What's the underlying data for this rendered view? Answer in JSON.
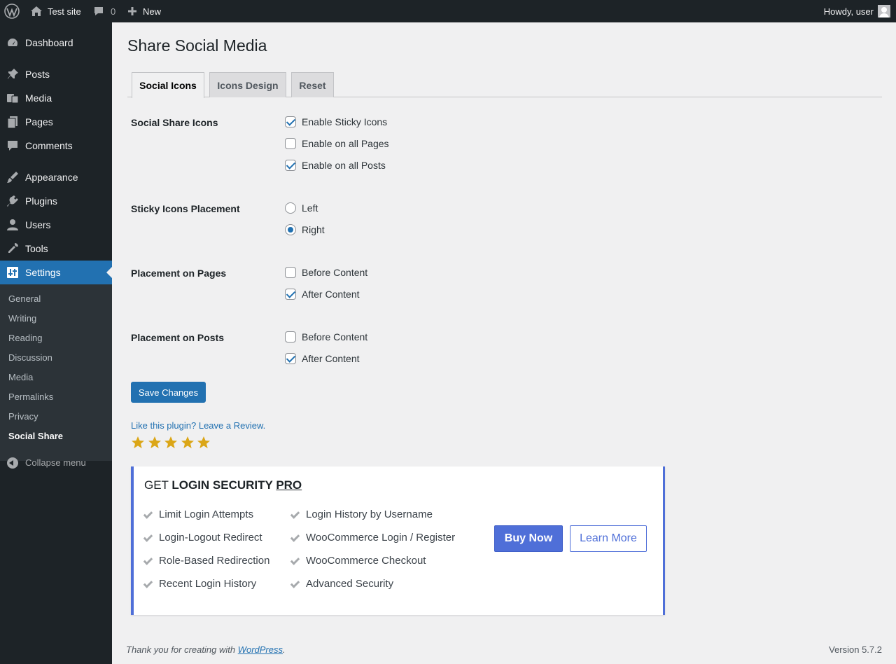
{
  "adminbar": {
    "site_name": "Test site",
    "comments_count": "0",
    "new_label": "New",
    "howdy": "Howdy, user"
  },
  "sidebar": {
    "items": [
      {
        "label": "Dashboard",
        "icon": "dashboard-icon"
      },
      {
        "label": "Posts",
        "icon": "pushpin-icon"
      },
      {
        "label": "Media",
        "icon": "media-icon"
      },
      {
        "label": "Pages",
        "icon": "pages-icon"
      },
      {
        "label": "Comments",
        "icon": "comment-icon"
      },
      {
        "label": "Appearance",
        "icon": "brush-icon"
      },
      {
        "label": "Plugins",
        "icon": "plugin-icon"
      },
      {
        "label": "Users",
        "icon": "user-icon"
      },
      {
        "label": "Tools",
        "icon": "wrench-icon"
      },
      {
        "label": "Settings",
        "icon": "settings-icon"
      }
    ],
    "submenu": [
      "General",
      "Writing",
      "Reading",
      "Discussion",
      "Media",
      "Permalinks",
      "Privacy",
      "Social Share"
    ],
    "collapse_label": "Collapse menu"
  },
  "page": {
    "title": "Share Social Media",
    "tabs": [
      "Social Icons",
      "Icons Design",
      "Reset"
    ]
  },
  "settings": {
    "social_share_icons": {
      "label": "Social Share Icons",
      "options": [
        {
          "label": "Enable Sticky Icons",
          "checked": true
        },
        {
          "label": "Enable on all Pages",
          "checked": false
        },
        {
          "label": "Enable on all Posts",
          "checked": true
        }
      ]
    },
    "sticky_placement": {
      "label": "Sticky Icons Placement",
      "options": [
        {
          "label": "Left",
          "checked": false
        },
        {
          "label": "Right",
          "checked": true
        }
      ]
    },
    "placement_pages": {
      "label": "Placement on Pages",
      "options": [
        {
          "label": "Before Content",
          "checked": false
        },
        {
          "label": "After Content",
          "checked": true
        }
      ]
    },
    "placement_posts": {
      "label": "Placement on Posts",
      "options": [
        {
          "label": "Before Content",
          "checked": false
        },
        {
          "label": "After Content",
          "checked": true
        }
      ]
    },
    "save_label": "Save Changes"
  },
  "review": {
    "link_text": "Like this plugin? Leave a Review.",
    "stars": 5
  },
  "promo": {
    "title_prefix": "GET ",
    "title_bold": "LOGIN SECURITY ",
    "title_pro": "PRO",
    "features_col1": [
      "Limit Login Attempts",
      "Login-Logout Redirect",
      "Role-Based Redirection",
      "Recent Login History"
    ],
    "features_col2": [
      "Login History by Username",
      "WooCommerce Login / Register",
      "WooCommerce Checkout",
      "Advanced Security"
    ],
    "buy_label": "Buy Now",
    "learn_label": "Learn More",
    "accent_color": "#4f6fd8"
  },
  "footer": {
    "thanks_prefix": "Thank you for creating with ",
    "wordpress_link": "WordPress",
    "thanks_suffix": ".",
    "version": "Version 5.7.2"
  }
}
